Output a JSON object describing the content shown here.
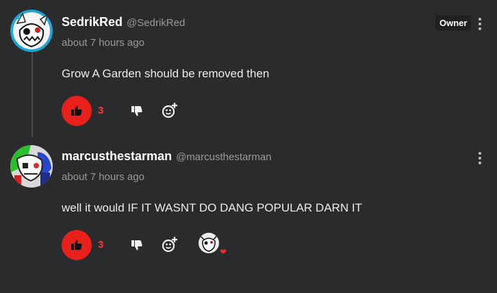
{
  "comments": [
    {
      "display_name": "SedrikRed",
      "handle": "@SedrikRed",
      "time": "about 7 hours ago",
      "badge": "Owner",
      "text": "Grow A Garden should be removed then",
      "like_count": "3",
      "avatar_icon": "white-creature-avatar-icon"
    },
    {
      "display_name": "marcusthestarman",
      "handle": "@marcusthestarman",
      "time": "about 7 hours ago",
      "text": "well it would IF IT WASNT DO DANG POPULAR DARN IT",
      "like_count": "3",
      "avatar_icon": "green-character-avatar-icon",
      "reaction_icon": "heart-icon"
    }
  ],
  "colors": {
    "background": "#2a2b2d",
    "like_button": "#e8201c",
    "like_count": "#ff3b34",
    "muted_text": "#9a9a9d"
  }
}
